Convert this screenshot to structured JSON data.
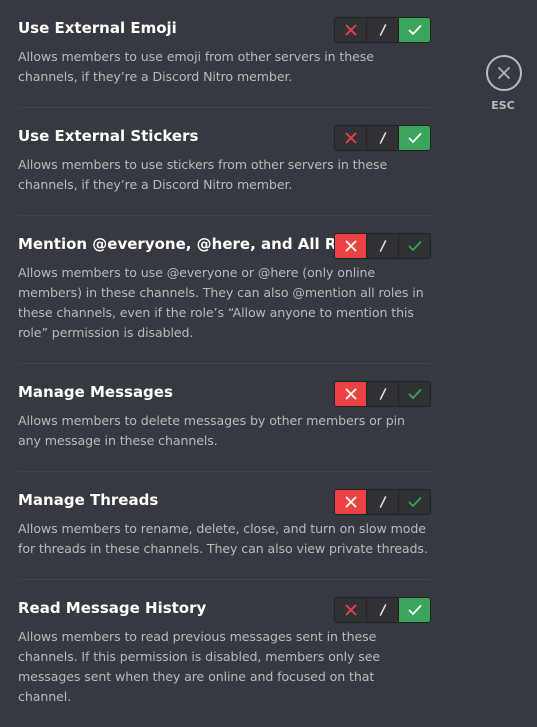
{
  "close": {
    "label": "ESC",
    "icon": "close-icon"
  },
  "permissions": [
    {
      "title": "Use External Emoji",
      "description": "Allows members to use emoji from other servers in these channels, if they’re a Discord Nitro member.",
      "state": "allow"
    },
    {
      "title": "Use External Stickers",
      "description": "Allows members to use stickers from other servers in these channels, if they’re a Discord Nitro member.",
      "state": "allow"
    },
    {
      "title": "Mention @everyone, @here, and All Roles",
      "description": "Allows members to use @everyone or @here (only online members) in these channels. They can also @mention all roles in these channels, even if the role’s “Allow anyone to mention this role” permission is disabled.",
      "state": "deny"
    },
    {
      "title": "Manage Messages",
      "description": "Allows members to delete messages by other members or pin any message in these channels.",
      "state": "deny"
    },
    {
      "title": "Manage Threads",
      "description": "Allows members to rename, delete, close, and turn on slow mode for threads in these channels. They can also view private threads.",
      "state": "deny"
    },
    {
      "title": "Read Message History",
      "description": "Allows members to read previous messages sent in these channels. If this permission is disabled, members only see messages sent when they are online and focused on that channel.",
      "state": "allow"
    }
  ],
  "colors": {
    "background": "#36393f",
    "deny": "#ed4245",
    "allow": "#3ba55c",
    "title": "#ffffff",
    "description": "#b9bbbe"
  }
}
